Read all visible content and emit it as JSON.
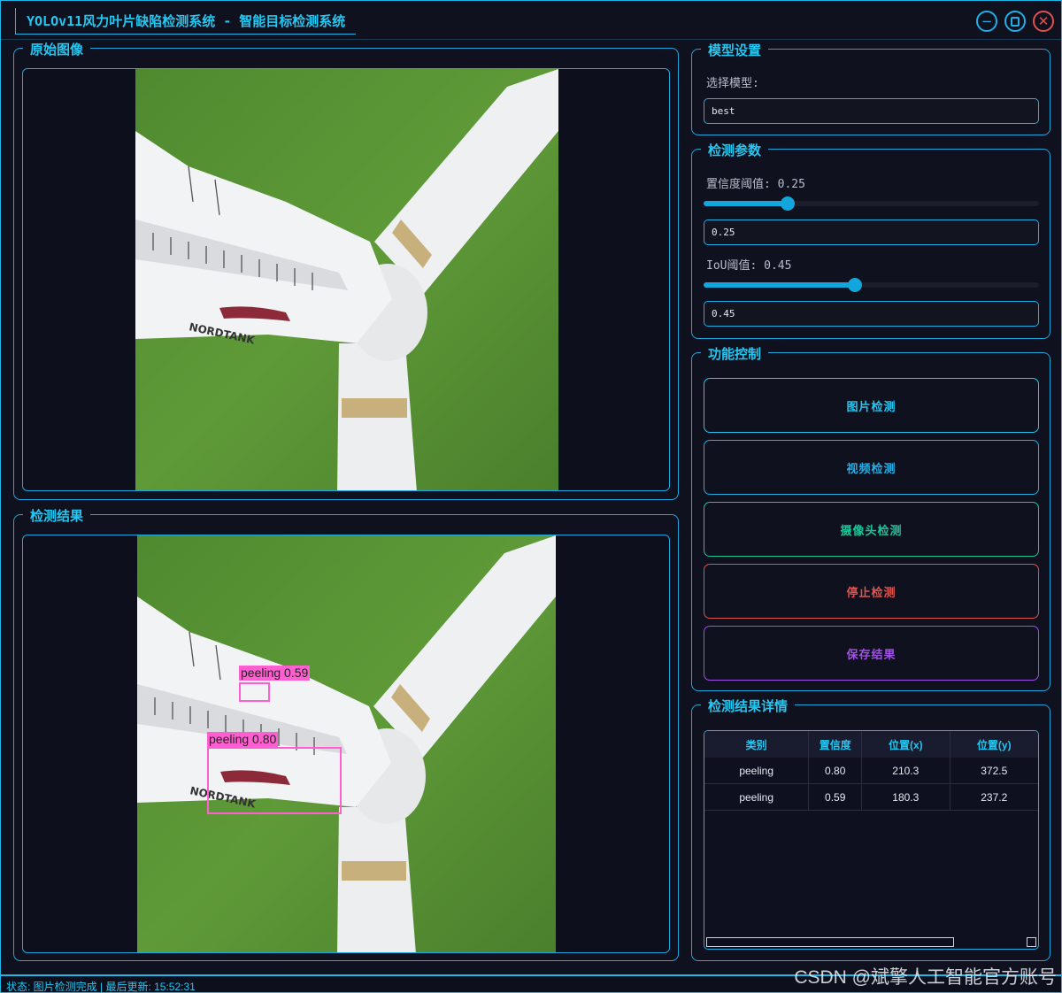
{
  "window": {
    "title": "YOLOv11风力叶片缺陷检测系统 - 智能目标检测系统",
    "minimize_icon": "minimize-icon",
    "maximize_icon": "maximize-icon",
    "close_icon": "close-icon"
  },
  "original_panel": {
    "title": "原始图像"
  },
  "result_panel": {
    "title": "检测结果",
    "detections": [
      {
        "label": "peeling 0.59"
      },
      {
        "label": "peeling 0.80"
      }
    ],
    "box_color": "#ff5fd0"
  },
  "model_settings": {
    "title": "模型设置",
    "select_label": "选择模型:",
    "selected_model": "best"
  },
  "detection_params": {
    "title": "检测参数",
    "confidence_label": "置信度阈值: 0.25",
    "confidence_value": "0.25",
    "confidence_level": 0.25,
    "iou_label": "IoU阈值: 0.45",
    "iou_value": "0.45",
    "iou_level": 0.45
  },
  "function_control": {
    "title": "功能控制",
    "image_detect": "图片检测",
    "video_detect": "视频检测",
    "camera_detect": "摄像头检测",
    "stop_detect": "停止检测",
    "save_result": "保存结果",
    "colors": {
      "image_detect": "#22c7f2",
      "video_detect": "#22aee6",
      "camera_detect": "#19c79a",
      "stop_detect": "#e0524c",
      "save_result": "#a050e8"
    }
  },
  "result_details": {
    "title": "检测结果详情",
    "columns": [
      "类别",
      "置信度",
      "位置(x)",
      "位置(y)"
    ],
    "rows": [
      [
        "peeling",
        "0.80",
        "210.3",
        "372.5"
      ],
      [
        "peeling",
        "0.59",
        "180.3",
        "237.2"
      ]
    ]
  },
  "status": {
    "text": "状态: 图片检测完成 | 最后更新: 15:52:31"
  },
  "watermark": "CSDN @斌擎人工智能官方账号"
}
